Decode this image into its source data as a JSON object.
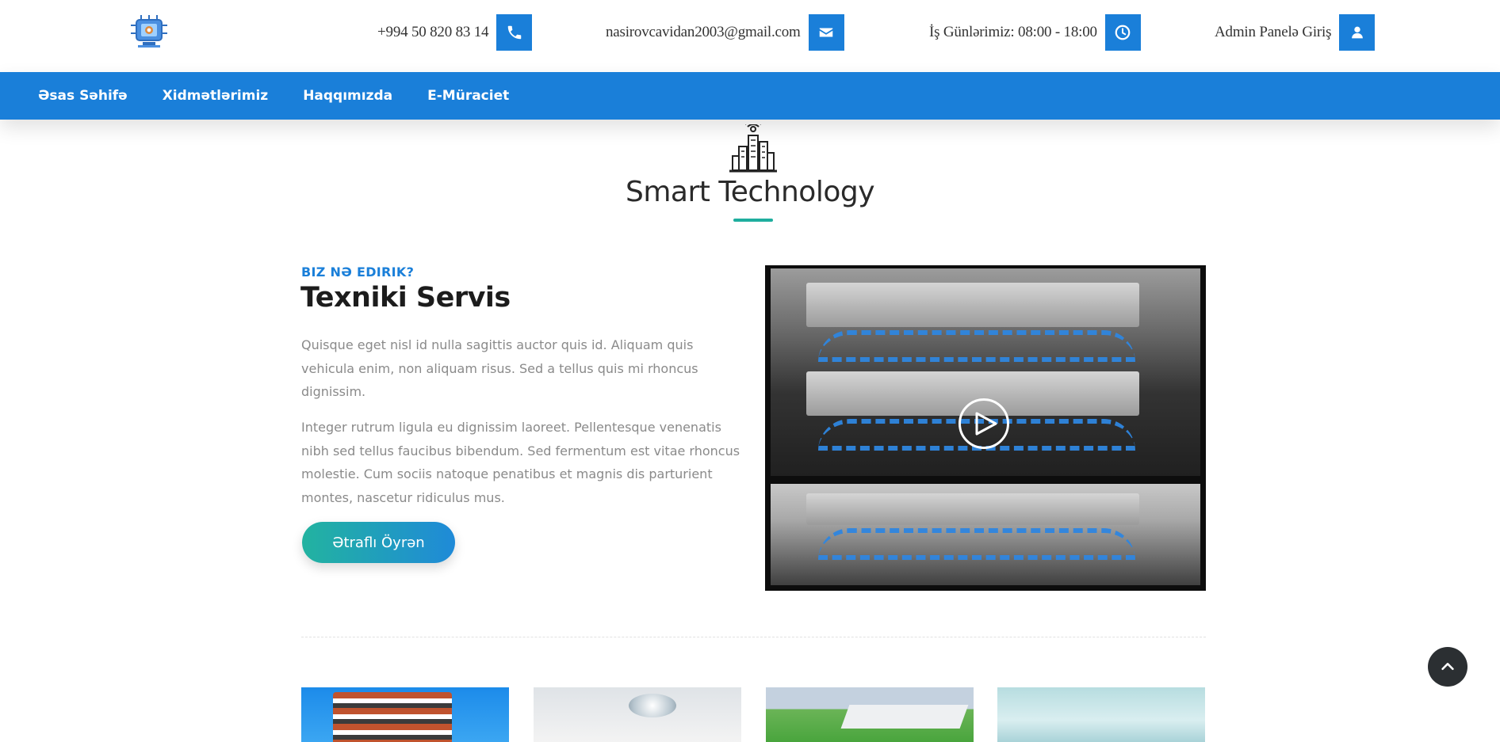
{
  "header": {
    "logo": "chip-logo",
    "phone": {
      "text": "+994 50 820 83 14",
      "icon": "phone-icon"
    },
    "email": {
      "text": "nasirovcavidan2003@gmail.com",
      "icon": "envelope-icon"
    },
    "hours": {
      "text": "İş Günlərimiz: 08:00 - 18:00",
      "icon": "clock-icon"
    },
    "admin": {
      "text": "Admin Panelə Giriş",
      "icon": "user-icon"
    },
    "accent_color": "#1a7fd9"
  },
  "nav": {
    "items": [
      {
        "label": "Əsas Səhifə"
      },
      {
        "label": "Xidmətlərimiz"
      },
      {
        "label": "Haqqımızda"
      },
      {
        "label": "E-Müraciet"
      }
    ]
  },
  "section": {
    "icon": "smart-city-icon",
    "title": "Smart Technology",
    "eyebrow": "BIZ NƏ EDIRIK?",
    "heading": "Texniki Servis",
    "paragraphs": [
      "Quisque eget nisl id nulla sagittis auctor quis id. Aliquam quis vehicula enim, non aliquam risus. Sed a tellus quis mi rhoncus dignissim.",
      "Integer rutrum ligula eu dignissim laoreet. Pellentesque venenatis nibh sed tellus faucibus bibendum. Sed fermentum est vitae rhoncus molestie. Cum sociis natoque penatibus et magnis dis parturient montes, nascetur ridiculus mus."
    ],
    "cta_label": "Ətraflı Öyrən",
    "video_icon": "play-icon",
    "line_color": "#1fae9e"
  },
  "thumbnails": [
    {
      "subject": "building"
    },
    {
      "subject": "operating-room"
    },
    {
      "subject": "factory"
    },
    {
      "subject": "hospital"
    }
  ],
  "back_to_top_icon": "chevron-up-icon"
}
